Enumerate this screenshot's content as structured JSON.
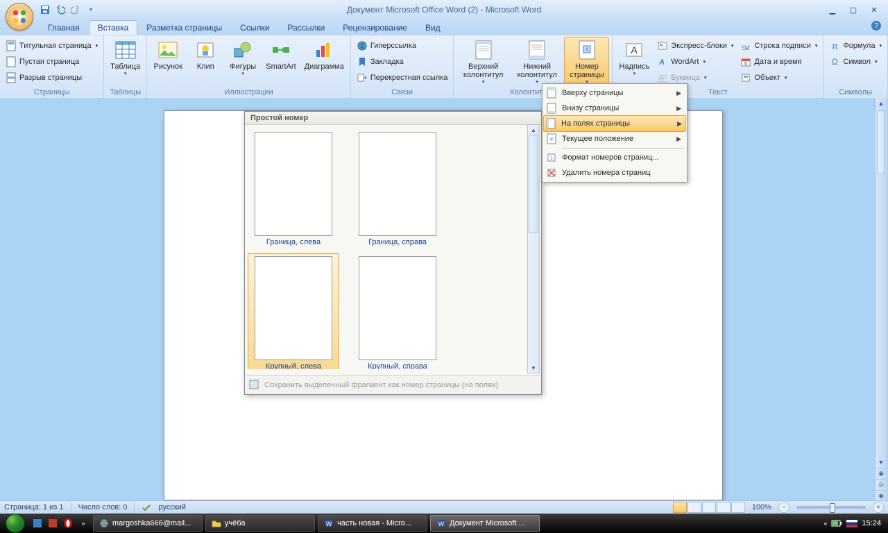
{
  "title": "Документ Microsoft Office Word (2) - Microsoft Word",
  "tabs": {
    "home": "Главная",
    "insert": "Вставка",
    "layout": "Разметка страницы",
    "refs": "Ссылки",
    "mail": "Рассылки",
    "review": "Рецензирование",
    "view": "Вид"
  },
  "groups": {
    "pages": {
      "label": "Страницы",
      "cover": "Титульная страница",
      "blank": "Пустая страница",
      "break": "Разрыв страницы"
    },
    "tables": {
      "label": "Таблицы",
      "table": "Таблица"
    },
    "illus": {
      "label": "Иллюстрации",
      "picture": "Рисунок",
      "clip": "Клип",
      "shapes": "Фигуры",
      "smartart": "SmartArt",
      "chart": "Диаграмма"
    },
    "links": {
      "label": "Связи",
      "hyper": "Гиперссылка",
      "book": "Закладка",
      "cross": "Перекрестная ссылка"
    },
    "hf": {
      "label": "Колонтитулы",
      "header": "Верхний колонтитул",
      "footer": "Нижний колонтитул",
      "pagenum": "Номер страницы"
    },
    "text": {
      "label": "Текст",
      "textbox": "Надпись",
      "quick": "Экспресс-блоки",
      "wordart": "WordArt",
      "dropcap": "Буквица",
      "sig": "Строка подписи",
      "date": "Дата и время",
      "obj": "Объект"
    },
    "sym": {
      "label": "Символы",
      "eq": "Формула",
      "sym": "Символ"
    }
  },
  "pn_menu": {
    "top": "Вверху страницы",
    "bottom": "Внизу страницы",
    "margins": "На полях страницы",
    "current": "Текущее положение",
    "format": "Формат номеров страниц...",
    "remove": "Удалить номера страниц"
  },
  "gallery": {
    "header": "Простой номер",
    "items": [
      "Граница, слева",
      "Граница, справа",
      "Крупный, слева",
      "Крупный, справа"
    ],
    "footer": "Сохранить выделенный фрагмент как номер страницы (на полях)"
  },
  "status": {
    "page": "Страница: 1 из 1",
    "words": "Число слов: 0",
    "lang": "русский",
    "zoom": "100%"
  },
  "taskbar": {
    "t1": "margoshka666@mail...",
    "t2": "учёба",
    "t3": "часть новая - Micro...",
    "t4": "Документ Microsoft ...",
    "clock": "15:24"
  }
}
